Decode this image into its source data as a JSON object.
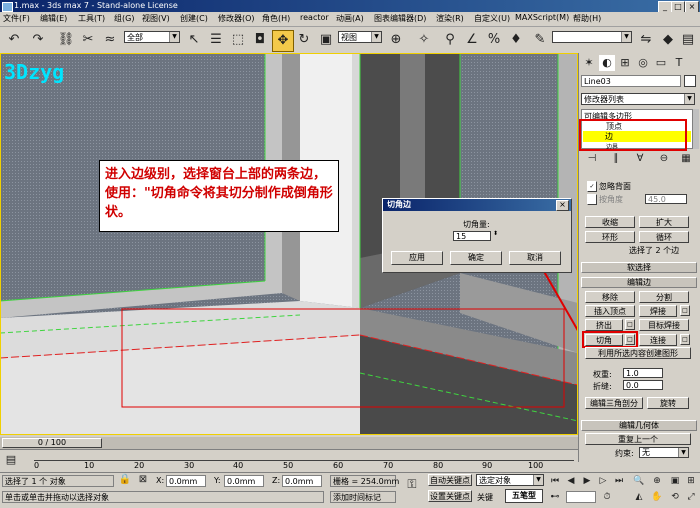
{
  "titlebar": {
    "title": "1.max - 3ds max 7 - Stand-alone License"
  },
  "menu": [
    "文件(F)",
    "编辑(E)",
    "工具(T)",
    "组(G)",
    "视图(V)",
    "创建(C)",
    "修改器(O)",
    "角色(H)",
    "reactor",
    "动画(A)",
    "图表编辑器(D)",
    "渲染(R)",
    "自定义(U)",
    "MAXScript(M)",
    "帮助(H)"
  ],
  "toolbar": {
    "selection_filter": "全部",
    "coord_system": "视图"
  },
  "viewport": {
    "label": "3Dzyg"
  },
  "annotation": {
    "text": "进入边级别，选择窗台上部的两条边，使用：\"切角命令将其切分制作成倒角形状。"
  },
  "dialog": {
    "title": "切角边",
    "amount_label": "切角量:",
    "amount_value": "15",
    "apply": "应用",
    "ok": "确定",
    "cancel": "取消"
  },
  "panel": {
    "object_name": "Line03",
    "modifier_list": "修改器列表",
    "stack": [
      "可编辑多边形",
      "顶点",
      "边",
      "边界"
    ],
    "selection": {
      "ignore_backfacing": "忽略背面",
      "by_angle": "按角度",
      "angle_value": "45.0",
      "shrink": "收缩",
      "grow": "扩大",
      "ring": "环形",
      "loop": "循环",
      "status": "选择了 2 个边"
    },
    "soft_selection": "软选择",
    "edit_edges": {
      "header": "编辑边",
      "remove": "移除",
      "split": "分割",
      "insert_vertex": "插入顶点",
      "weld": "焊接",
      "extrude": "挤出",
      "target_weld": "目标焊接",
      "chamfer": "切角",
      "connect": "连接",
      "create_shape": "利用所选内容创建图形",
      "weight_label": "权重:",
      "weight_value": "1.0",
      "crease_label": "折缝:",
      "crease_value": "0.0",
      "edit_tri": "编辑三角剖分",
      "turn": "旋转"
    },
    "edit_geometry": {
      "header": "编辑几何体",
      "repeat_last": "重复上一个",
      "constraints_label": "约束:",
      "constraints_value": "无"
    }
  },
  "timeline": {
    "slider_label": "0 / 100",
    "ticks": [
      "0",
      "10",
      "20",
      "30",
      "40",
      "50",
      "60",
      "70",
      "80",
      "90",
      "100"
    ]
  },
  "status": {
    "selected": "选择了 1 个 对象",
    "hint": "单击或单击并拖动以选择对象",
    "x_label": "X:",
    "x_value": "0.0mm",
    "y_label": "Y:",
    "y_value": "0.0mm",
    "z_label": "Z:",
    "z_value": "0.0mm",
    "grid": "栅格 = 254.0mm",
    "add_time_tag": "添加时间标记",
    "auto_key": "自动关键点",
    "set_key": "设置关键点",
    "key_filter": "选定对象",
    "key_filter2": "关键",
    "logo": "五笔型"
  }
}
